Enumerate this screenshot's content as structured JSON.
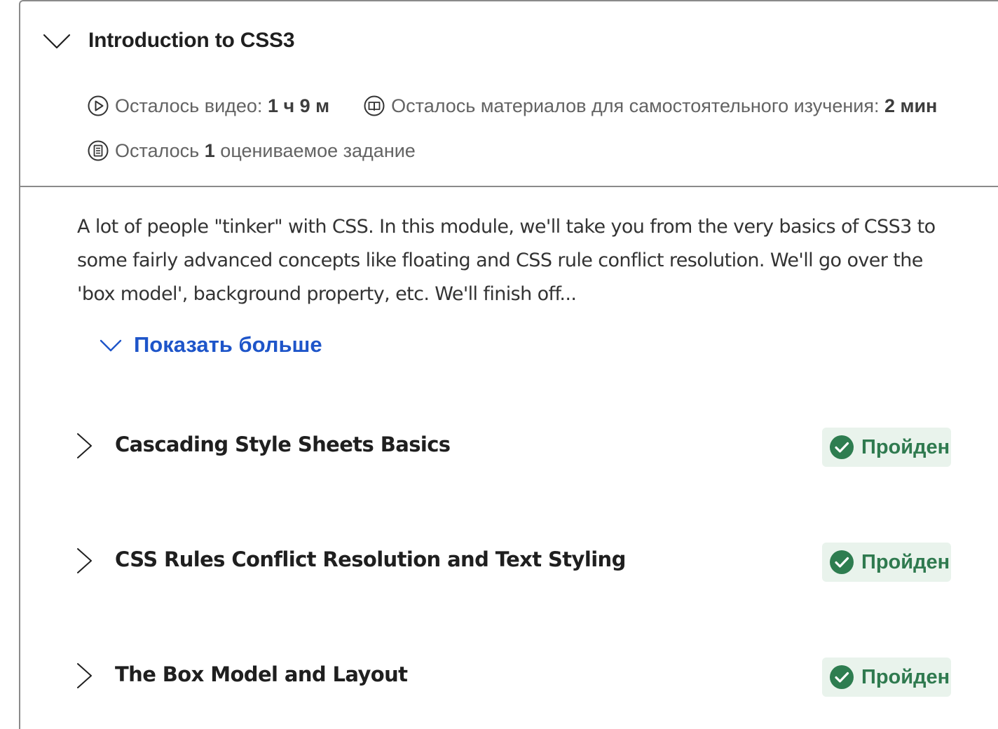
{
  "module": {
    "title": "Introduction to CSS3",
    "meta": {
      "video_prefix": "Осталось видео:",
      "video_value": "1 ч 9 м",
      "reading_prefix": "Осталось материалов для самостоятельного изучения:",
      "reading_value": "2 мин",
      "graded_prefix": "Осталось",
      "graded_value": "1",
      "graded_suffix": "оцениваемое задание"
    },
    "description": "A lot of people \"tinker\" with CSS. In this module, we'll take you from the very basics of CSS3 to some fairly advanced concepts like floating and CSS rule conflict resolution. We'll go over the 'box model', background property, etc. We'll finish off...",
    "show_more_label": "Показать больше"
  },
  "lessons": [
    {
      "title": "Cascading Style Sheets Basics",
      "status": "Пройден"
    },
    {
      "title": "CSS Rules Conflict Resolution and Text Styling",
      "status": "Пройден"
    },
    {
      "title": "The Box Model and Layout",
      "status": "Пройден"
    }
  ],
  "icons": {
    "collapse": "chevron-down-icon",
    "video": "play-circle-icon",
    "reading": "book-open-icon",
    "graded": "assignment-icon",
    "lesson_expand": "chevron-right-icon",
    "completed": "check-circle-icon"
  },
  "colors": {
    "link": "#1e55c9",
    "completed_text": "#2f7a4f",
    "completed_bg": "#e9f3ec",
    "check_fill": "#2e7d50"
  }
}
